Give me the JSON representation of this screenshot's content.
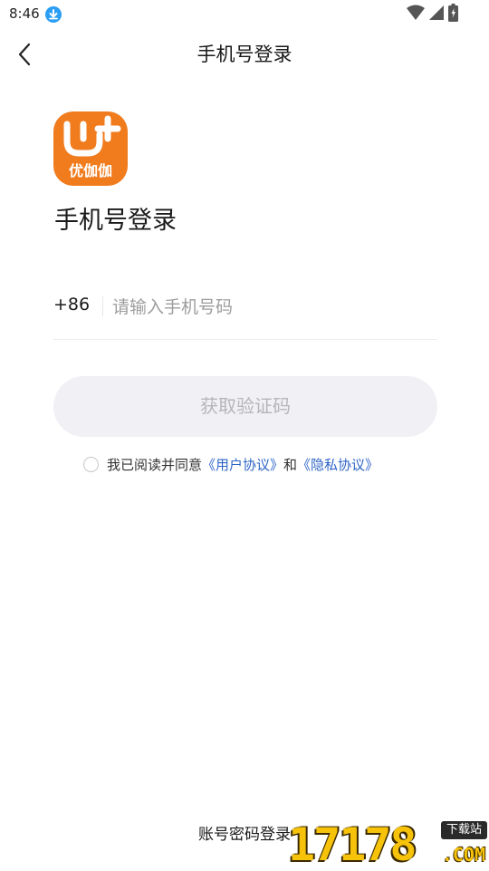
{
  "status_bar": {
    "time": "8:46",
    "icons": [
      "download-icon",
      "wifi-icon",
      "signal-icon",
      "battery-icon"
    ]
  },
  "nav": {
    "title": "手机号登录",
    "back_icon": "chevron-left-icon"
  },
  "logo": {
    "text": "优伽伽",
    "color": "#f07c1e"
  },
  "heading": "手机号登录",
  "phone_field": {
    "country_code": "+86",
    "placeholder": "请输入手机号码",
    "value": ""
  },
  "get_code_button": {
    "label": "获取验证码",
    "state": "disabled",
    "bg_color": "#f1f1f5"
  },
  "agreement": {
    "checked": false,
    "prefix": "我已阅读并同意",
    "user_agreement": "《用户协议》",
    "connector": "和",
    "privacy_policy": "《隐私协议》",
    "link_color": "#2f65c6"
  },
  "alt_login": {
    "label": "账号密码登录"
  },
  "watermark": {
    "digits": "17178",
    "tag": "下载站",
    "suffix": ".COM"
  }
}
